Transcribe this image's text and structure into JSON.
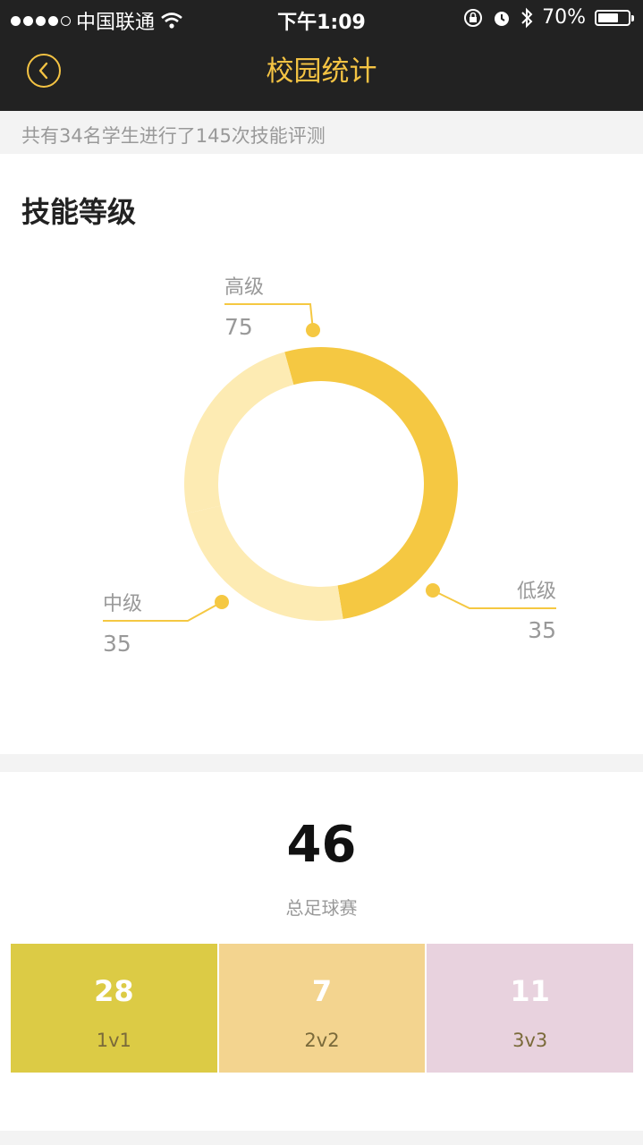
{
  "status_bar": {
    "carrier": "中国联通",
    "time": "下午1:09",
    "battery": "70%",
    "battery_level": 0.7,
    "signal_bars_filled": 4,
    "signal_bars_total": 5,
    "icons": [
      "wifi-icon",
      "orientation-lock-icon",
      "alarm-icon",
      "bluetooth-icon",
      "battery-icon"
    ]
  },
  "nav": {
    "title": "校园统计",
    "back_icon": "chevron-left-icon"
  },
  "summary": {
    "text": "共有34名学生进行了145次技能评测"
  },
  "skill_section": {
    "title": "技能等级"
  },
  "chart_data": {
    "type": "pie",
    "title": "技能等级",
    "slices": [
      {
        "label": "高级",
        "value": 75,
        "color": "#f5c842"
      },
      {
        "label": "低级",
        "value": 35,
        "color": "#fdebb3"
      },
      {
        "label": "中级",
        "value": 35,
        "color": "#fdebb3"
      }
    ]
  },
  "matches": {
    "total": "46",
    "total_label": "总足球赛",
    "tiles": [
      {
        "value": "28",
        "label": "1v1",
        "color": "#dccb45"
      },
      {
        "value": "7",
        "label": "2v2",
        "color": "#f3d48f"
      },
      {
        "value": "11",
        "label": "3v3",
        "color": "#e8d2de"
      }
    ]
  },
  "colors": {
    "accent": "#f4c343",
    "dark": "#222222",
    "muted_text": "#999999",
    "leader_line": "#f5c842"
  }
}
